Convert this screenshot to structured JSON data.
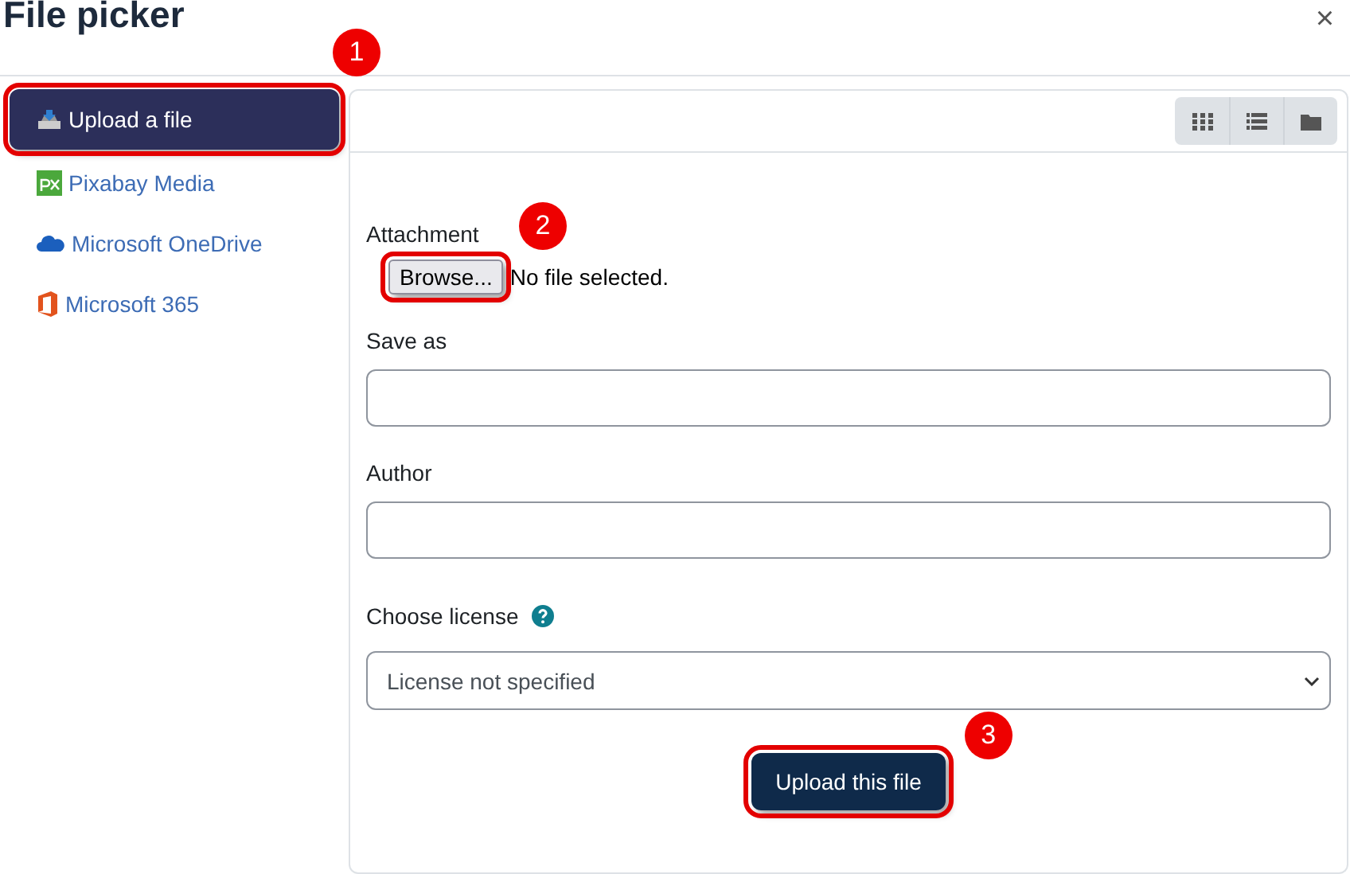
{
  "dialog": {
    "title": "File picker",
    "close": "×"
  },
  "sources": [
    {
      "label": "Upload a file",
      "kind": "upload",
      "selected": true,
      "callout": "1"
    },
    {
      "label": "Pixabay Media",
      "kind": "pixabay",
      "selected": false
    },
    {
      "label": "Microsoft OneDrive",
      "kind": "onedrive",
      "selected": false
    },
    {
      "label": "Microsoft 365",
      "kind": "office",
      "selected": false
    }
  ],
  "toolbar": {
    "views": [
      {
        "kind": "grid"
      },
      {
        "kind": "list"
      },
      {
        "kind": "folder"
      }
    ]
  },
  "form": {
    "attachment": {
      "label": "Attachment",
      "button": "Browse...",
      "status": "No file selected.",
      "callout": "2"
    },
    "fields": [
      {
        "label": "Save as"
      },
      {
        "label": "Author"
      }
    ],
    "license": {
      "label": "Choose license",
      "value": "License not specified"
    },
    "submit": {
      "label": "Upload this file",
      "callout": "3"
    }
  }
}
